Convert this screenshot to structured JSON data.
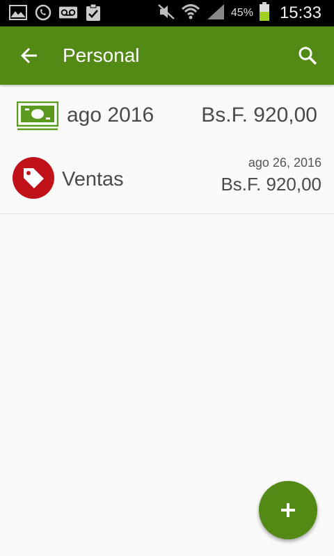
{
  "status_bar": {
    "icons_left": [
      "gallery-icon",
      "whatsapp-icon",
      "voicemail-icon",
      "clipboard-check-icon"
    ],
    "icons_right": [
      "mute-icon",
      "wifi-icon",
      "signal-icon"
    ],
    "battery_percent": "45%",
    "clock": "15:33"
  },
  "app_bar": {
    "title": "Personal",
    "background_color": "#538a15"
  },
  "period": {
    "label": "ago 2016",
    "amount": "Bs.F. 920,00",
    "icon": "money-bill-icon"
  },
  "transactions": [
    {
      "name": "Ventas",
      "date": "ago 26, 2016",
      "amount": "Bs.F. 920,00",
      "icon": "tag-icon",
      "icon_color": "#c1121a"
    }
  ],
  "fab": {
    "icon": "plus-icon"
  }
}
